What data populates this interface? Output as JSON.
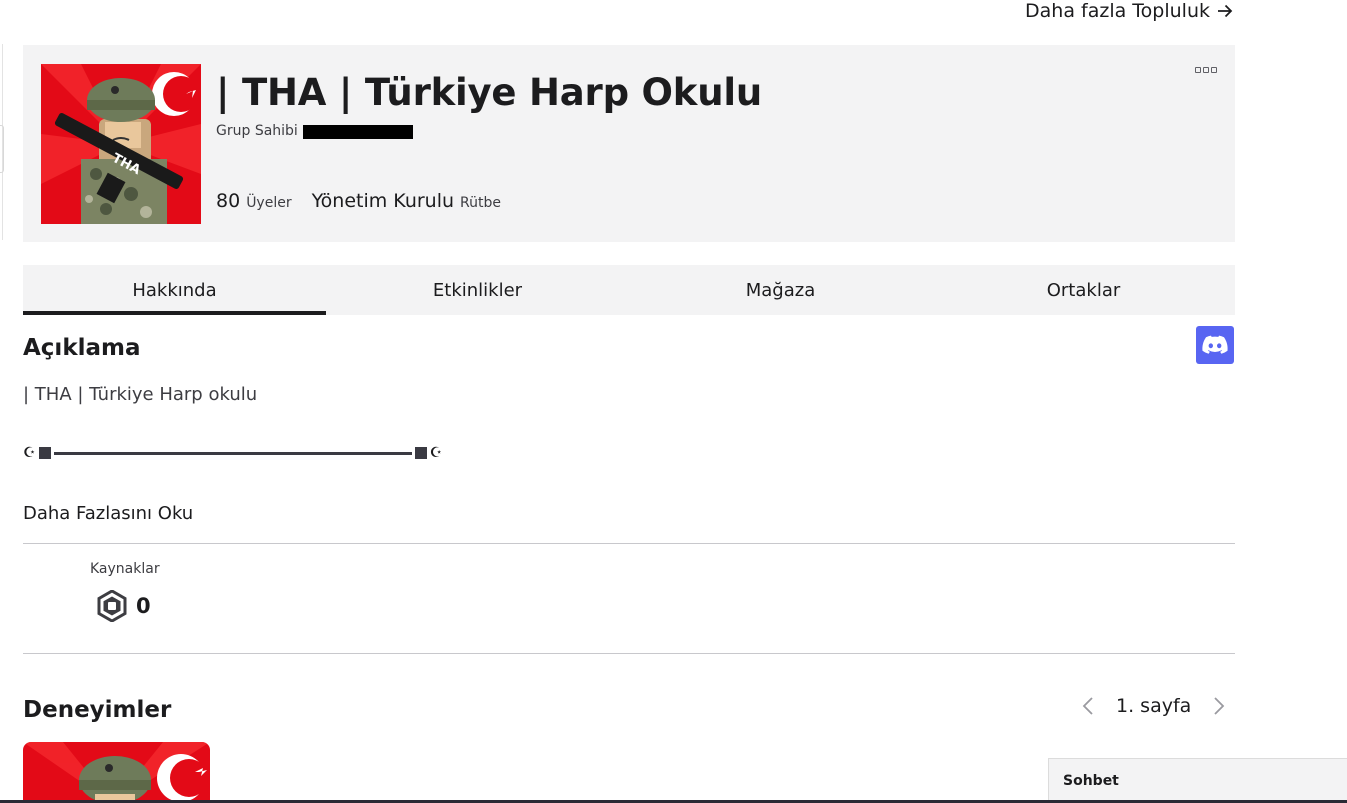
{
  "nav": {
    "more_communities": "Daha fazla Topluluk"
  },
  "group": {
    "name": "| THA | Türkiye Harp Okulu",
    "owner_label": "Grup Sahibi",
    "members_count": "80",
    "members_label": "Üyeler",
    "rank_value": "Yönetim Kurulu",
    "rank_label": "Rütbe",
    "badge_text": "THA"
  },
  "tabs": [
    {
      "label": "Hakkında",
      "active": true
    },
    {
      "label": "Etkinlikler",
      "active": false
    },
    {
      "label": "Mağaza",
      "active": false
    },
    {
      "label": "Ortaklar",
      "active": false
    }
  ],
  "description": {
    "title": "Açıklama",
    "line1": "| THA | Türkiye Harp okulu",
    "read_more": "Daha Fazlasını Oku"
  },
  "resources": {
    "label": "Kaynaklar",
    "value": "0"
  },
  "experiences": {
    "title": "Deneyimler",
    "page_label": "1. sayfa"
  },
  "chat": {
    "label": "Sohbet"
  },
  "colors": {
    "accent_discord": "#5865f2",
    "header_bg": "#f3f3f4",
    "flag_red": "#e30a17"
  },
  "icons": [
    "arrow-right-icon",
    "more-options-icon",
    "discord-icon",
    "robux-icon",
    "chevron-left-icon",
    "chevron-right-icon"
  ]
}
